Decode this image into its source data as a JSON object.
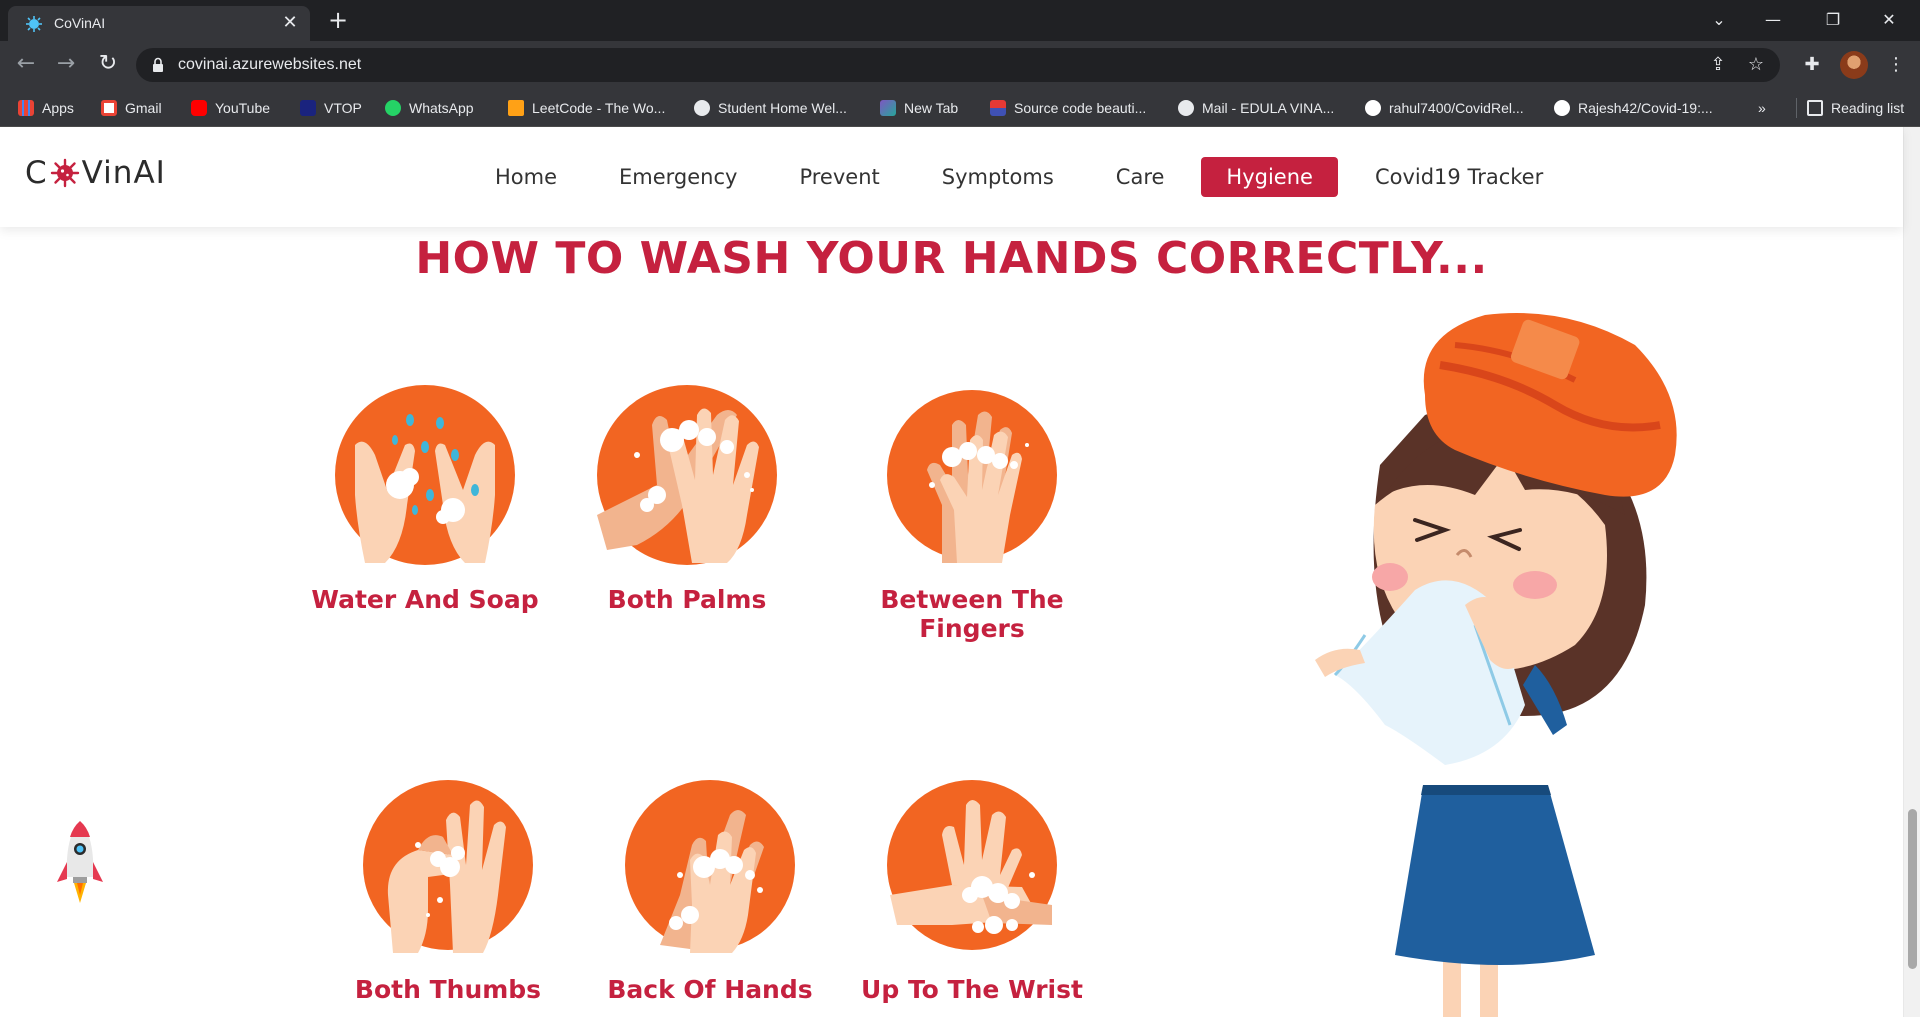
{
  "browser": {
    "tab_title": "CoVinAI",
    "tab_close": "✕",
    "new_tab": "+",
    "url": "covinai.azurewebsites.net",
    "window_controls": {
      "minimize": "—",
      "restore": "❐",
      "close": "✕",
      "tab_search": "⌄"
    },
    "bookmarks": [
      {
        "label": "Apps",
        "icon": "apps-grid-icon",
        "color": "#4285f4"
      },
      {
        "label": "Gmail",
        "icon": "gmail-icon",
        "color": "#ea4335"
      },
      {
        "label": "YouTube",
        "icon": "youtube-icon",
        "color": "#ff0000"
      },
      {
        "label": "VTOP",
        "icon": "vtop-icon",
        "color": "#1a237e"
      },
      {
        "label": "WhatsApp",
        "icon": "whatsapp-icon",
        "color": "#25d366"
      },
      {
        "label": "LeetCode - The Wo...",
        "icon": "leetcode-icon",
        "color": "#ffa116"
      },
      {
        "label": "Student Home Wel...",
        "icon": "globe-icon",
        "color": "#e8eaed"
      },
      {
        "label": "New Tab",
        "icon": "new-tab-icon",
        "color": "#7e57c2"
      },
      {
        "label": "Source code beauti...",
        "icon": "source-code-icon",
        "color": "#3f51b5"
      },
      {
        "label": "Mail - EDULA VINA...",
        "icon": "globe-icon",
        "color": "#e8eaed"
      },
      {
        "label": "rahul7400/CovidRel...",
        "icon": "github-icon",
        "color": "#ffffff"
      },
      {
        "label": "Rajesh42/Covid-19:...",
        "icon": "github-icon",
        "color": "#ffffff"
      }
    ],
    "bookmarks_overflow": "»",
    "reading_list": "Reading list"
  },
  "site": {
    "logo_prefix": "C",
    "logo_suffix": "VinAI",
    "accent_color": "#c5213f",
    "nav": [
      {
        "label": "Home",
        "active": false
      },
      {
        "label": "Emergency",
        "active": false
      },
      {
        "label": "Prevent",
        "active": false
      },
      {
        "label": "Symptoms",
        "active": false
      },
      {
        "label": "Care",
        "active": false
      },
      {
        "label": "Hygiene",
        "active": true
      },
      {
        "label": "Covid19 Tracker",
        "active": false
      }
    ],
    "headline": "HOW TO WASH YOUR HANDS CORRECTLY...",
    "steps": [
      {
        "label": "Water And Soap",
        "icon": "water-and-soap-icon"
      },
      {
        "label": "Both Palms",
        "icon": "both-palms-icon"
      },
      {
        "label": "Between The Fingers",
        "icon": "between-fingers-icon"
      },
      {
        "label": "Both Thumbs",
        "icon": "both-thumbs-icon"
      },
      {
        "label": "Back Of Hands",
        "icon": "back-of-hands-icon"
      },
      {
        "label": "Up To The Wrist",
        "icon": "up-to-wrist-icon"
      }
    ]
  }
}
